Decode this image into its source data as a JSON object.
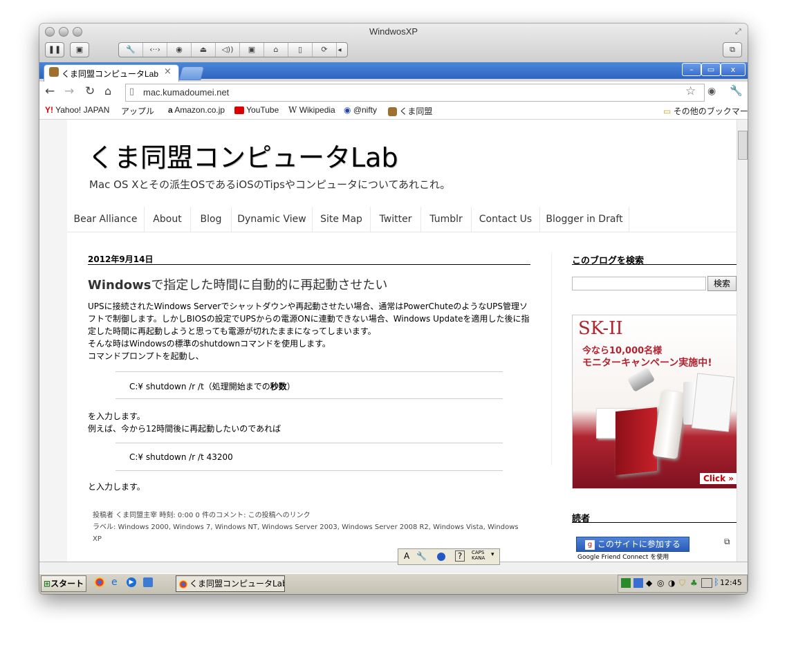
{
  "mac_window": {
    "title": "WindwosXP",
    "toolbar_icons": [
      "pause-icon",
      "vm-list-icon",
      "wrench-icon",
      "network-icon",
      "cd-icon",
      "disk-icon",
      "sound-icon",
      "usb-icon",
      "printer-icon",
      "mouse-icon",
      "sync-icon",
      "collapse-icon",
      "fullscreen-icon"
    ]
  },
  "browser": {
    "tab_title": "くま同盟コンピュータLab",
    "tab_close": "×",
    "url": "mac.kumadoumei.net",
    "bookmarks": [
      "Yahoo! JAPAN",
      "アップル",
      "Amazon.co.jp",
      "YouTube",
      "Wikipedia",
      "@nifty",
      "くま同盟"
    ],
    "other_bookmarks": "その他のブックマーク",
    "window_controls": {
      "minimize": "–",
      "maximize": "▭",
      "close": "x"
    }
  },
  "page": {
    "blog_title": "くま同盟コンピュータLab",
    "blog_description": "Mac OS Xとその派生OSであるiOSのTipsやコンピュータについてあれこれ。",
    "tabs": [
      "Bear Alliance",
      "About",
      "Blog",
      "Dynamic View",
      "Site Map",
      "Twitter",
      "Tumblr",
      "Contact Us",
      "Blogger in Draft"
    ],
    "post": {
      "date": "2012年9月14日",
      "title": "Windowsで指定した時間に自動的に再起動させたい",
      "body_lines": [
        "UPSに接続されたWindows Serverでシャットダウンや再起動させたい場合、通常はPowerChuteのようなUPS管理ソ",
        "フトで制御します。しかしBIOSの設定でUPSからの電源ONに連動できない場合、Windows Updateを適用した後に指",
        "定した時間に再起動しようと思っても電源が切れたままになってしまいます。",
        "そんな時はWindowsの標準のshutdownコマンドを使用します。",
        "コマンドプロンプトを起動し、"
      ],
      "code1_prefix": "C:¥ shutdown /r /t（処理開始までの",
      "code1_bold": "秒数",
      "code1_suffix": "）",
      "middle_lines": [
        "を入力します。",
        "例えば、今から12時間後に再起動したいのであれば"
      ],
      "code2": "C:¥ shutdown /r /t 43200",
      "after_text": "と入力します。",
      "meta_line1": "投稿者 くま同盟主宰 時刻: 0:00    0 件のコメント:    この投稿へのリンク",
      "meta_line2": "ラベル: Windows 2000, Windows 7, Windows NT, Windows Server 2003, Windows Server 2008 R2, Windows Vista, Windows",
      "meta_line3": "XP"
    },
    "sidebar": {
      "search_heading": "このブログを検索",
      "search_button": "検索",
      "ad_brand": "SK-II",
      "ad_line1": "今なら10,000名様",
      "ad_line2": "モニターキャンペーン実施中!",
      "ad_click": "Click »",
      "readers_heading": "読者",
      "join_button": "このサイトに参加する",
      "gfc_text": "Google Friend Connect を使用"
    }
  },
  "taskbar": {
    "start": "スタート",
    "task_item": "くま同盟コンピュータLab...",
    "clock": "12:45",
    "ime_caps": "CAPS",
    "ime_kana": "KANA"
  },
  "colors": {
    "xp_blue": "#3a6fd0",
    "ad_red": "#b02430",
    "mac_chrome": "#d6d6d6"
  }
}
